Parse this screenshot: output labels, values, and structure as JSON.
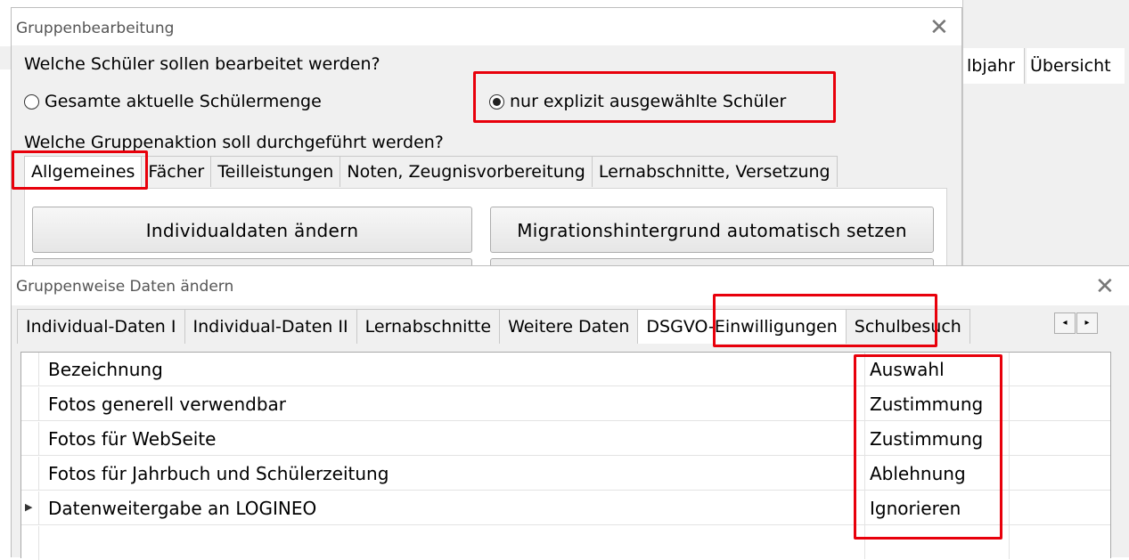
{
  "background_window": {
    "tabs": [
      "lbjahr",
      "Übersicht"
    ]
  },
  "group_dialog": {
    "title": "Gruppenbearbeitung",
    "close_icon": "close-icon",
    "question_students": "Welche Schüler sollen bearbeitet werden?",
    "radio_all": {
      "label": "Gesamte aktuelle Schülermenge",
      "checked": false
    },
    "radio_explicit": {
      "label": "nur explizit ausgewählte Schüler",
      "checked": true
    },
    "question_action": "Welche Gruppenaktion soll durchgeführt werden?",
    "tabs": [
      "Allgemeines",
      "Fächer",
      "Teilleistungen",
      "Noten, Zeugnisvorbereitung",
      "Lernabschnitte, Versetzung"
    ],
    "active_tab": "Allgemeines",
    "buttons": {
      "individual": "Individualdaten ändern",
      "migration": "Migrationshintergrund automatisch setzen"
    }
  },
  "group_data_dialog": {
    "title": "Gruppenweise Daten ändern",
    "close_icon": "close-icon",
    "tabs": [
      "Individual-Daten I",
      "Individual-Daten II",
      "Lernabschnitte",
      "Weitere Daten",
      "DSGVO-Einwilligungen",
      "Schulbesuch"
    ],
    "active_tab": "DSGVO-Einwilligungen",
    "scroll_left": "◂",
    "scroll_right": "▸",
    "grid": {
      "headers": {
        "name": "Bezeichnung",
        "choice": "Auswahl"
      },
      "rows": [
        {
          "name": "Fotos generell verwendbar",
          "choice": "Zustimmung"
        },
        {
          "name": "Fotos für WebSeite",
          "choice": "Zustimmung"
        },
        {
          "name": "Fotos für Jahrbuch und Schülerzeitung",
          "choice": "Ablehnung"
        },
        {
          "name": "Datenweitergabe an LOGINEO",
          "choice": "Ignorieren"
        }
      ],
      "current_row_indicator": "▶"
    }
  },
  "colors": {
    "highlight": "#e8000b",
    "window_bg": "#f0f0f0"
  }
}
